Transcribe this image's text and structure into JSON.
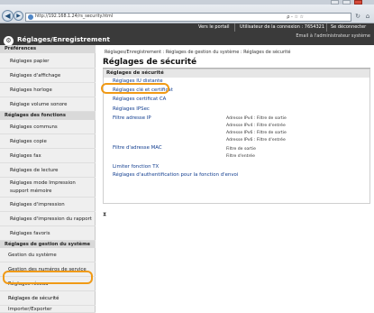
{
  "browser": {
    "url": "http://192.168.1.24/rs_security.html",
    "search": "ρ - ☆ ☆"
  },
  "header": {
    "title": "Réglages/Enregistrement",
    "links": [
      "Vers le portail",
      "Utilisateur de la connexion : 7654321",
      "Se déconnecter"
    ],
    "admin": "Email à l'administrateur système"
  },
  "sidebar": {
    "sections": [
      {
        "title": "Préférences",
        "items": [
          "Réglages papier",
          "Réglages d'affichage",
          "Réglages horloge",
          "Réglage volume sonore"
        ]
      },
      {
        "title": "Réglages des fonctions",
        "items": [
          "Réglages communs",
          "Réglages copie",
          "Réglages fax",
          "Réglages de lecture",
          "Réglages mode Impression support mémoire",
          "Réglages d'impression",
          "Réglages d'impression du rapport",
          "Réglages favoris"
        ]
      },
      {
        "title": "Réglages de gestion du système",
        "items": [
          "Gestion du système",
          "Gestion des numéros de service",
          "Réglages réseau",
          "Réglages de sécurité",
          "Importer/Exporter"
        ]
      }
    ]
  },
  "main": {
    "breadcrumb": "Réglages/Enregistrement : Réglages de gestion du système : Réglages de sécurité",
    "title": "Réglages de sécurité",
    "panel_title": "Réglages de sécurité",
    "links": [
      "Réglages IU distante",
      "Réglages clé et certificat",
      "Réglages certificat CA",
      "Réglages IPSec",
      "Filtre adresse IP",
      "Filtre d'adresse MAC",
      "Limiter fonction TX",
      "Réglages d'authentification pour la fonction d'envoi"
    ],
    "ip_filter_notes": [
      "Adresse IPv4 : Filtre de sortie",
      "Adresse IPv4 : Filtre d'entrée",
      "Adresse IPv6 : Filtre de sortie",
      "Adresse IPv6 : Filtre d'entrée"
    ],
    "mac_filter_notes": [
      "Filtre de sortie",
      "Filtre d'entrée"
    ]
  },
  "colors": {
    "header": "#3a3a3a",
    "highlight": "#f09a16",
    "link": "#113d8f"
  }
}
